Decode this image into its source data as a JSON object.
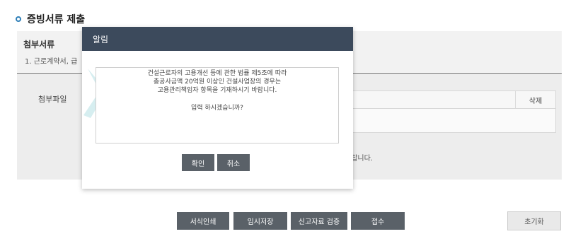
{
  "page": {
    "section_title": "증빙서류 제출"
  },
  "attach": {
    "title": "첨부서류",
    "desc": "1. 근로계약서, 급"
  },
  "files": {
    "label": "첨부파일",
    "delete_col": "삭제",
    "note": "라랍니다."
  },
  "buttons": {
    "print": "서식인쇄",
    "temp_save": "임시저장",
    "verify": "신고자료 검증",
    "submit": "접수",
    "reset": "초기화"
  },
  "modal": {
    "title": "알림",
    "line1": "건설근로자의 고용개선 등에 관한 법률 제5조에 따라",
    "line2": "총공사금액 20억원 이상인 건설사업장의 경우는",
    "line3": "고용관리책임자 항목을 기재하시기 바랍니다.",
    "question": "입력 하시겠습니까?",
    "confirm": "확인",
    "cancel": "취소"
  },
  "colors": {
    "modal_header": "#3c4a5c",
    "button_dark": "#5a6168",
    "title_dot": "#2f7fb8"
  }
}
